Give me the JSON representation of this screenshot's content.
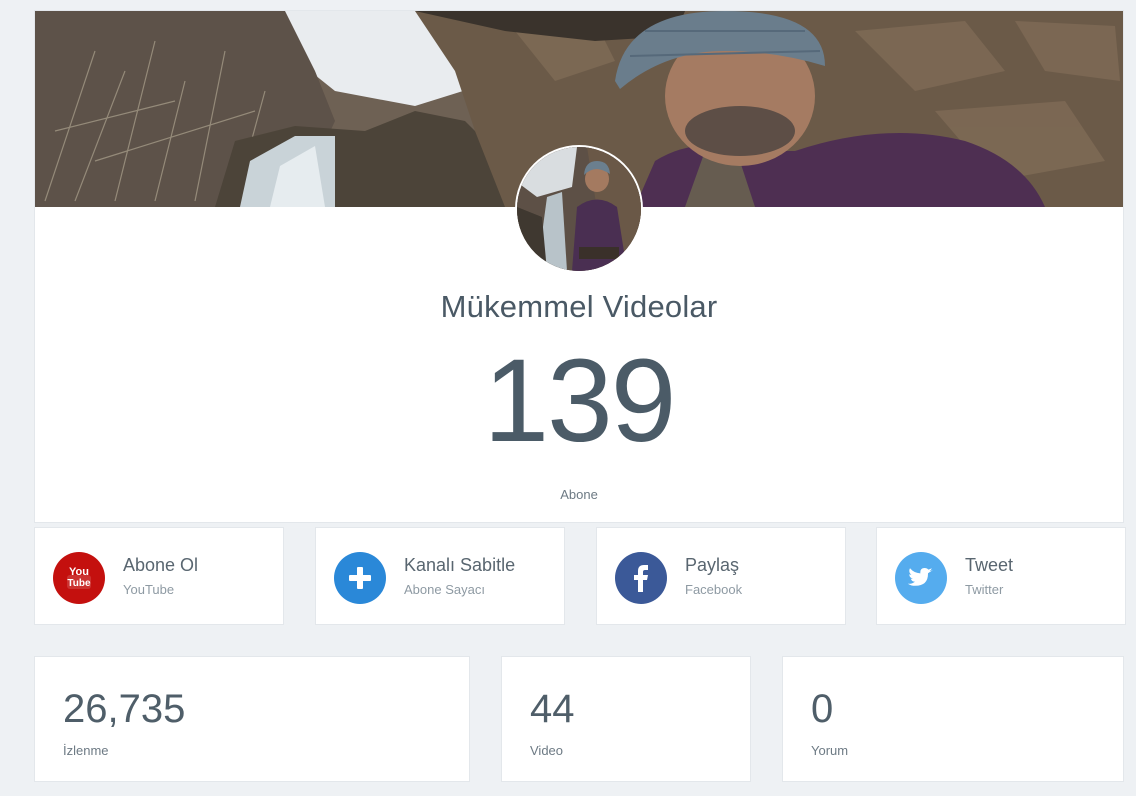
{
  "channel": {
    "name": "Mükemmel Videolar",
    "subscriber_count": "139",
    "subscriber_label": "Abone"
  },
  "actions": [
    {
      "title": "Abone Ol",
      "subtitle": "YouTube",
      "icon": "youtube-icon",
      "color": "#c4100e",
      "icon_text_top": "You",
      "icon_text_bottom": "Tube"
    },
    {
      "title": "Kanalı Sabitle",
      "subtitle": "Abone Sayacı",
      "icon": "plus-icon",
      "color": "#2a88d8"
    },
    {
      "title": "Paylaş",
      "subtitle": "Facebook",
      "icon": "facebook-icon",
      "color": "#3b5998"
    },
    {
      "title": "Tweet",
      "subtitle": "Twitter",
      "icon": "twitter-icon",
      "color": "#55acee"
    }
  ],
  "stats": [
    {
      "value": "26,735",
      "label": "İzlenme"
    },
    {
      "value": "44",
      "label": "Video"
    },
    {
      "value": "0",
      "label": "Yorum"
    }
  ]
}
